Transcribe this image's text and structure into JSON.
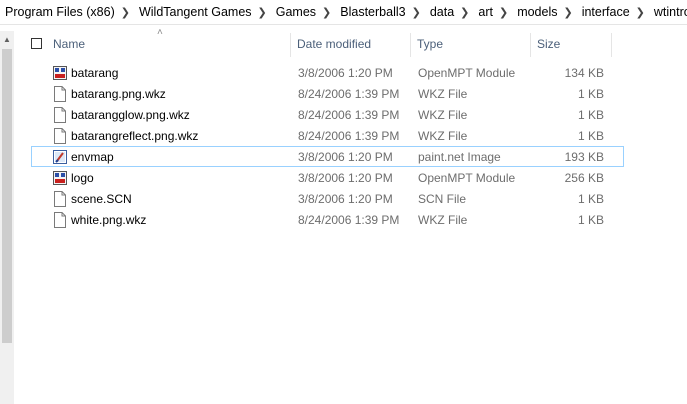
{
  "breadcrumb": [
    "Program Files (x86)",
    "WildTangent Games",
    "Games",
    "Blasterball3",
    "data",
    "art",
    "models",
    "interface",
    "wtintro"
  ],
  "columns": {
    "name": "Name",
    "date": "Date modified",
    "type": "Type",
    "size": "Size"
  },
  "files": [
    {
      "name": "batarang",
      "date": "3/8/2006 1:20 PM",
      "type": "OpenMPT Module",
      "size": "134 KB",
      "icon": "openmpt-module-icon"
    },
    {
      "name": "batarang.png.wkz",
      "date": "8/24/2006 1:39 PM",
      "type": "WKZ File",
      "size": "1 KB",
      "icon": "blank-file-icon"
    },
    {
      "name": "batarangglow.png.wkz",
      "date": "8/24/2006 1:39 PM",
      "type": "WKZ File",
      "size": "1 KB",
      "icon": "blank-file-icon"
    },
    {
      "name": "batarangreflect.png.wkz",
      "date": "8/24/2006 1:39 PM",
      "type": "WKZ File",
      "size": "1 KB",
      "icon": "blank-file-icon"
    },
    {
      "name": "envmap",
      "date": "3/8/2006 1:20 PM",
      "type": "paint.net Image",
      "size": "193 KB",
      "icon": "paintnet-image-icon",
      "selected": true
    },
    {
      "name": "logo",
      "date": "3/8/2006 1:20 PM",
      "type": "OpenMPT Module",
      "size": "256 KB",
      "icon": "openmpt-module-icon"
    },
    {
      "name": "scene.SCN",
      "date": "3/8/2006 1:20 PM",
      "type": "SCN File",
      "size": "1 KB",
      "icon": "blank-file-icon"
    },
    {
      "name": "white.png.wkz",
      "date": "8/24/2006 1:39 PM",
      "type": "WKZ File",
      "size": "1 KB",
      "icon": "blank-file-icon"
    }
  ]
}
